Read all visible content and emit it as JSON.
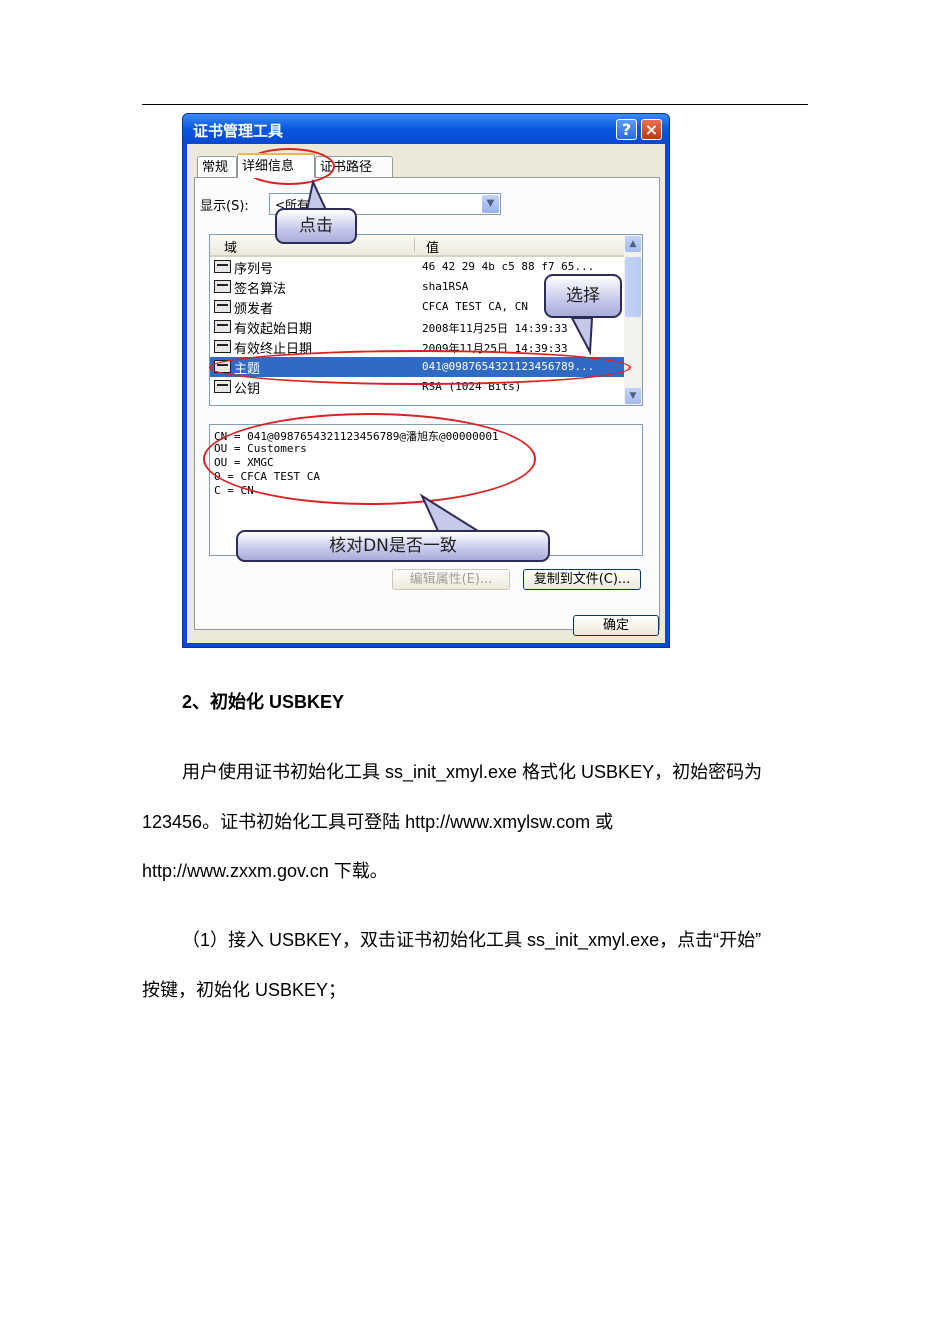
{
  "dialog": {
    "title": "证书管理工具",
    "help_glyph": "?",
    "close_glyph": "×",
    "tabs": [
      {
        "label": "常规"
      },
      {
        "label": "详细信息"
      },
      {
        "label": "证书路径"
      }
    ],
    "show_label": "显示(S):",
    "show_value": "<所有>",
    "columns": {
      "field": "域",
      "value": "值"
    },
    "rows": [
      {
        "field": "序列号",
        "value": "46 42 29 4b c5 88 f7 65..."
      },
      {
        "field": "签名算法",
        "value": "sha1RSA"
      },
      {
        "field": "颁发者",
        "value": "CFCA TEST CA, CN"
      },
      {
        "field": "有效起始日期",
        "value": "2008年11月25日 14:39:33"
      },
      {
        "field": "有效终止日期",
        "value": "2009年11月25日 14:39:33"
      },
      {
        "field": "主题",
        "value": "041@0987654321123456789..."
      },
      {
        "field": "公钥",
        "value": "RSA (1024 Bits)"
      }
    ],
    "selected_row": 5,
    "detail_lines": [
      "CN = 041@0987654321123456789@潘旭东@00000001",
      "OU = Customers",
      "OU = XMGC",
      "O = CFCA TEST CA",
      "C = CN"
    ],
    "buttons": {
      "edit": "编辑属性(E)...",
      "copy": "复制到文件(C)...",
      "ok": "确定"
    }
  },
  "callouts": {
    "click": "点击",
    "select": "选择",
    "verify": "核对DN是否一致"
  },
  "doc": {
    "heading": "2、初始化 USBKEY",
    "para1_line1": "用户使用证书初始化工具 ss_init_xmyl.exe 格式化 USBKEY，初始密码为",
    "para1_line2": "123456。证书初始化工具可登陆 http://www.xmylsw.com 或",
    "para1_line3": "http://www.zxxm.gov.cn 下载。",
    "para2_line1": "（1）接入 USBKEY，双击证书初始化工具 ss_init_xmyl.exe，点击“开始”",
    "para2_line2": "按键，初始化 USBKEY；"
  }
}
